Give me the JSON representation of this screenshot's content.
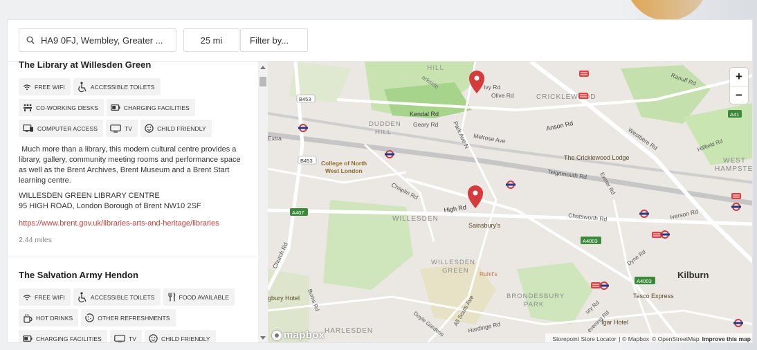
{
  "search": {
    "value": "HA9 0FJ, Wembley, Greater ...",
    "distance": "25 mi",
    "filter_placeholder": "Filter by..."
  },
  "locations": [
    {
      "title": "The Library at Willesden Green",
      "tags": [
        {
          "icon": "wifi-icon",
          "label": "FREE WIFI"
        },
        {
          "icon": "wheelchair-icon",
          "label": "ACCESSIBLE TOILETS"
        },
        {
          "icon": "people-icon",
          "label": "CO-WORKING DESKS"
        },
        {
          "icon": "battery-icon",
          "label": "CHARGING FACILITIES"
        },
        {
          "icon": "computer-icon",
          "label": "COMPUTER ACCESS"
        },
        {
          "icon": "tv-icon",
          "label": "TV"
        },
        {
          "icon": "smiley-icon",
          "label": "CHILD FRIENDLY"
        }
      ],
      "description": "Much more than a library, this modern cultural centre provides a library, gallery, community meeting rooms and performance space as well as the Brent Archives, Brent Museum and a Brent Start learning centre.",
      "address_line1": "WILLESDEN GREEN LIBRARY CENTRE",
      "address_line2": "95 HIGH ROAD, London Borough of Brent NW10 2SF",
      "url": "https://www.brent.gov.uk/libraries-arts-and-heritage/libraries",
      "distance": "2.44 miles"
    },
    {
      "title": "The Salvation Army Hendon",
      "tags": [
        {
          "icon": "wifi-icon",
          "label": "FREE WIFI"
        },
        {
          "icon": "wheelchair-icon",
          "label": "ACCESSIBLE TOILETS"
        },
        {
          "icon": "fork-knife-icon",
          "label": "FOOD AVAILABLE"
        },
        {
          "icon": "cup-icon",
          "label": "HOT DRINKS"
        },
        {
          "icon": "cookie-icon",
          "label": "OTHER REFRESHMENTS"
        },
        {
          "icon": "battery-icon",
          "label": "CHARGING FACILITIES"
        },
        {
          "icon": "tv-icon",
          "label": "TV"
        },
        {
          "icon": "smiley-icon",
          "label": "CHILD FRIENDLY"
        }
      ]
    }
  ],
  "map": {
    "labels": {
      "hill": "HILL",
      "ivy_rd": "Ivy Rd",
      "olive_rd": "Olive Rd",
      "cricklewood": "CRICKLEWOOD",
      "ranulf_rd": "Ranulf Rd",
      "b453_a": "B453",
      "b453_b": "B453",
      "a41": "A41",
      "a407": "A407",
      "a4003_a": "A4003",
      "a4003_b": "A4003",
      "kendal_rd": "Kendal Rd",
      "geary_rd": "Geary Rd",
      "dudden": "DUDDEN",
      "dudden_hill": "HILL",
      "park_ave_n": "Park Ave N",
      "melrose_ave": "Melrose Ave",
      "anson_rd": "Anson Rd",
      "westbere_rd": "Westbere Rd",
      "hillfield_rd": "Hillfield Rd",
      "extra": "Extra",
      "college_1": "College of North",
      "college_2": "West London",
      "cricklewood_lodge": "The Cricklewood Lodge",
      "west": "WEST",
      "hampstead": "HAMPSTE",
      "teignmouth_rd": "Teignmouth Rd",
      "exeter_rd": "Exeter Rd",
      "chaplin_rd": "Chaplin Rd",
      "high_rd": "High Rd",
      "sainsburys": "Sainsbury's",
      "willesden": "WILLESDEN",
      "chatsworth_rd": "Chatsworth Rd",
      "iverson_rd": "Iverson Rd",
      "church_rd": "Church Rd",
      "willesden_green_1": "WILLESDEN",
      "willesden_green_2": "GREEN",
      "ruhits": "Ruhit's",
      "dyne_rd": "Dyne Rd",
      "kilburn": "Kilburn",
      "tesco": "Tesco Express",
      "burns_rd": "Burns Rd",
      "all_souls_ave": "All Souls Ave",
      "brondesbury_1": "BRONDESBURY",
      "brondesbury_2": "PARK",
      "doyle_gardens": "Doyle Gardens",
      "hardinge_rd": "Hardinge Rd",
      "harlesden": "HARLESDEN",
      "bury_hotel": "gbury Hotel",
      "igar_hotel": "Igar Hotel",
      "brondesbury_rd": "ury Rd",
      "evening_rd": "evening Rd",
      "parkside": "arkside"
    },
    "zoom_in": "+",
    "zoom_out": "−",
    "attribution": {
      "store_locator": "Storepoint Store Locator",
      "mapbox": "| © Mapbox",
      "osm": "© OpenStreetMap",
      "improve": "Improve this map"
    },
    "logo": "mapbox"
  }
}
